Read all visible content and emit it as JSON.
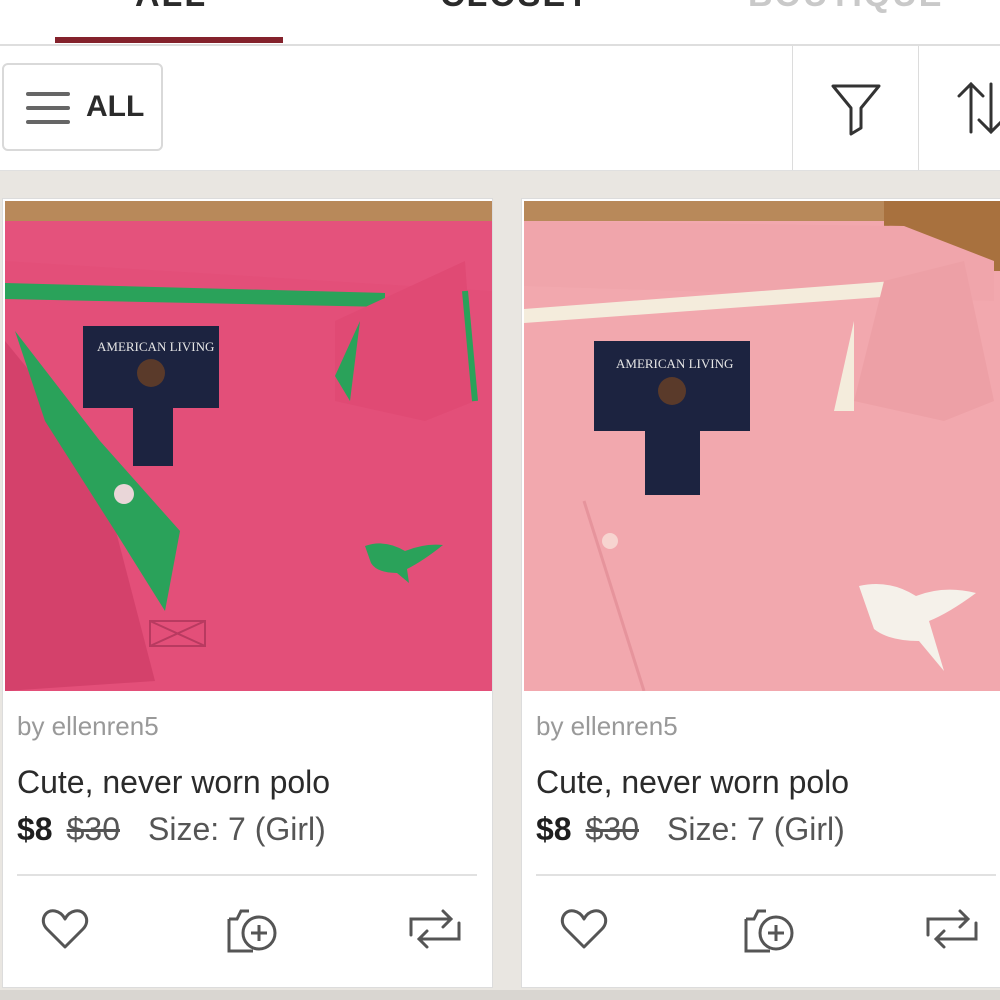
{
  "tabs": [
    {
      "label": "ALL",
      "active": true
    },
    {
      "label": "CLOSET",
      "active": false
    },
    {
      "label": "BOUTIQUE",
      "active": false
    }
  ],
  "filter_bar": {
    "all_label": "ALL",
    "menu_icon": "hamburger-icon",
    "filter_icon": "funnel-icon",
    "sort_icon": "sort-arrows-icon"
  },
  "colors": {
    "accent": "#84222c",
    "background": "#e9e6e1"
  },
  "listings": [
    {
      "seller": "by ellenren5",
      "title": "Cute, never worn polo",
      "price": "$8",
      "original_price": "$30",
      "size": "Size: 7 (Girl)",
      "image": "pink-polo-green-trim"
    },
    {
      "seller": "by ellenren5",
      "title": "Cute, never worn polo",
      "price": "$8",
      "original_price": "$30",
      "size": "Size: 7 (Girl)",
      "image": "light-pink-polo-white-trim"
    }
  ],
  "card_actions": [
    "heart-icon",
    "add-to-bundle-icon",
    "share-icon"
  ]
}
